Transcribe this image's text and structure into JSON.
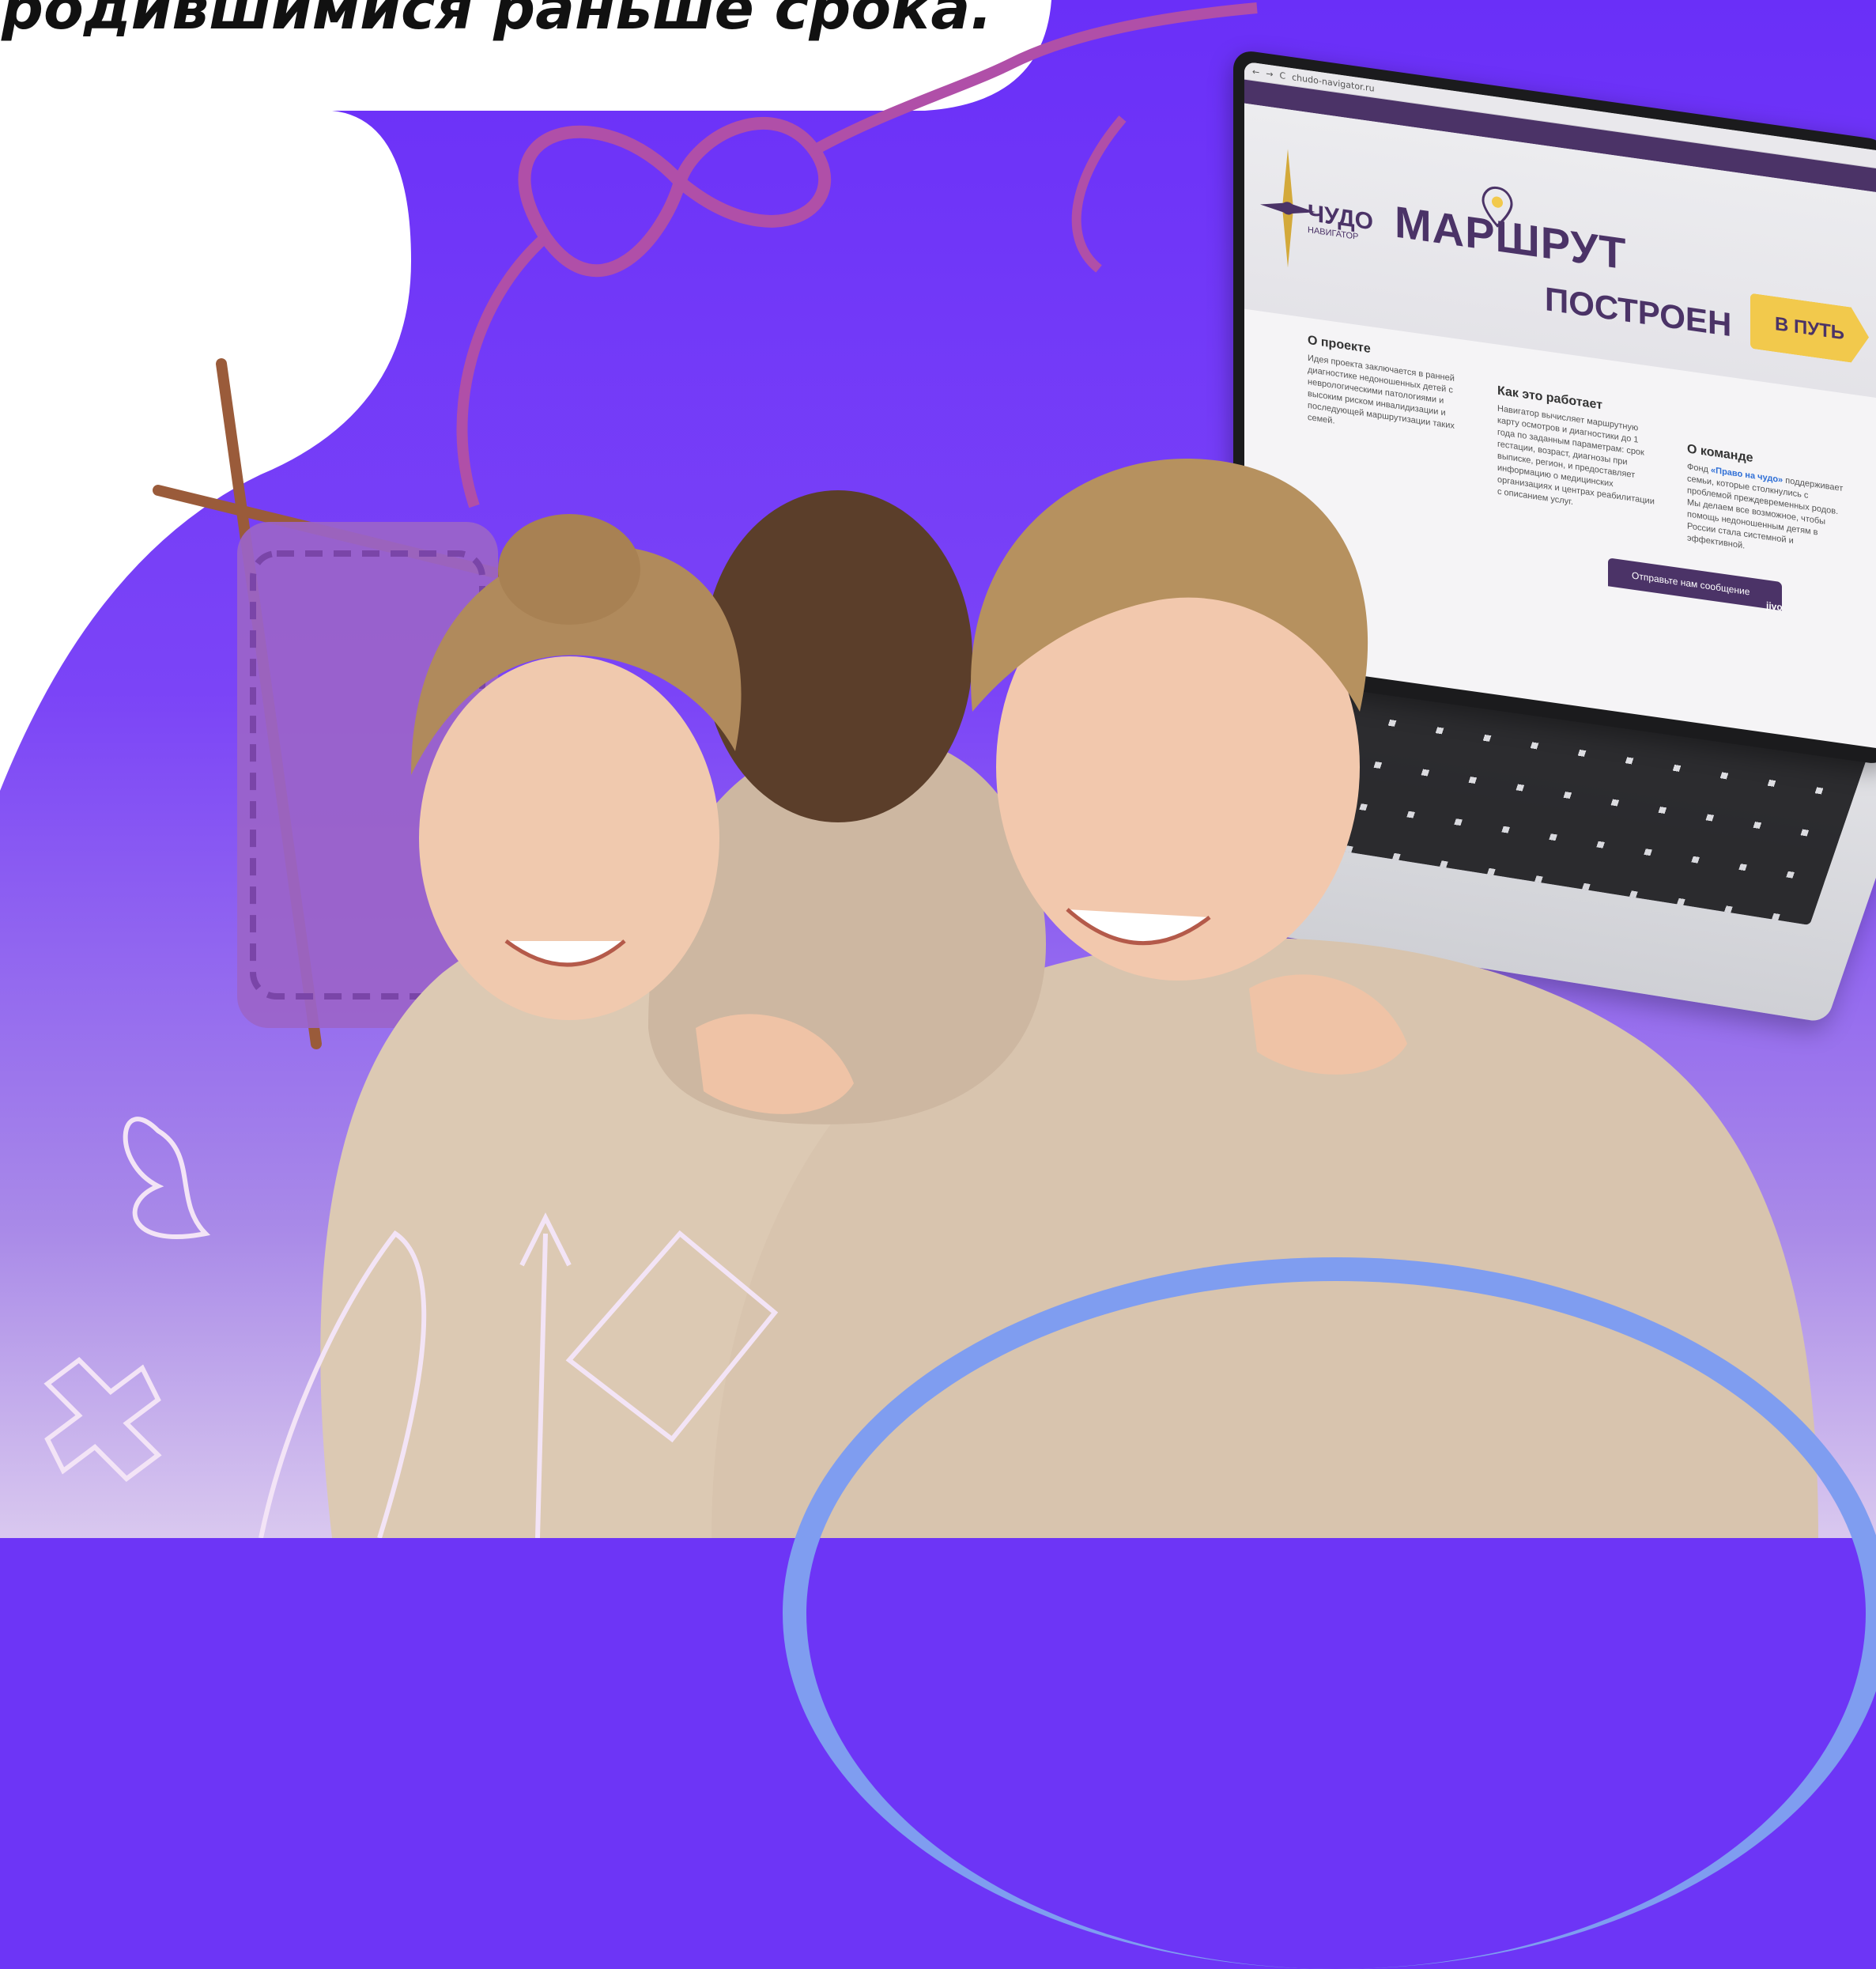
{
  "headline": "родившимися раньше срока.",
  "laptop_site": {
    "url": "chudo-navigator.ru",
    "logo_title": "ЧУДО",
    "logo_subtitle": "НАВИГАТОР",
    "hero_title": "МАРШРУТ",
    "hero_subtitle": "ПОСТРОЕН",
    "cta_label": "В ПУТЬ",
    "sections": [
      {
        "title": "О проекте",
        "text": "Идея проекта заключается в ранней диагностике недоношенных детей с неврологическими патологиями и высоким риском инвалидизации и последующей маршрутизации таких семей."
      },
      {
        "title": "Как это работает",
        "text": "Навигатор вычисляет маршрутную карту осмотров и диагностики до 1 года по заданным параметрам: срок гестации, возраст, диагнозы при выписке, регион, и предоставляет информацию о медицинских организациях и центрах реабилитации с описанием услуг."
      },
      {
        "title": "О команде",
        "text_prefix": "Фонд",
        "link": "«Право на чудо»",
        "text": "поддерживает семьи, которые столкнулись с проблемой преждевременных родов. Мы делаем все возможное, чтобы помощь недоношенным детям в России стала системной и эффективной."
      }
    ],
    "chat_label": "Отправьте нам сообщение",
    "chat_brand": "jivo"
  },
  "colors": {
    "background": "#6d35f6",
    "site_purple": "#4b3367",
    "cta_yellow": "#f2c94c",
    "arc_blue": "#7f9df0"
  }
}
